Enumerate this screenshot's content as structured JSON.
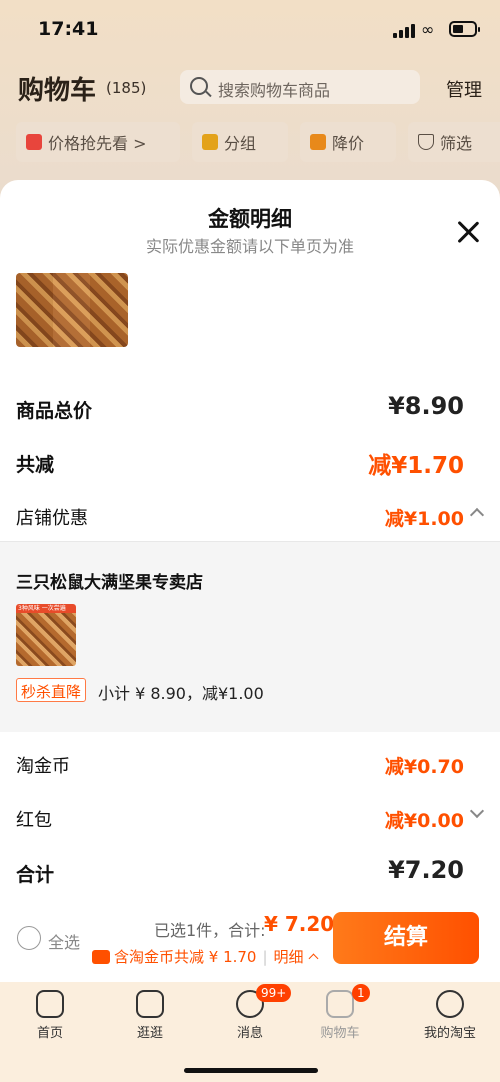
{
  "status_bar": {
    "time": "17:41"
  },
  "cart_header": {
    "title": "购物车",
    "count": "(185)",
    "search_placeholder": "搜索购物车商品",
    "manage": "管理"
  },
  "filter_chips": [
    {
      "label": "价格抢先看 >",
      "icon": "price-tag-icon"
    },
    {
      "label": "分组",
      "icon": "folder-icon"
    },
    {
      "label": "降价",
      "icon": "down-arrow-icon"
    },
    {
      "label": "筛选",
      "icon": "filter-icon"
    }
  ],
  "sheet": {
    "title": "金额明细",
    "subtitle": "实际优惠金额请以下单页为准",
    "rows": {
      "total_price": {
        "label": "商品总价",
        "value": "¥8.90"
      },
      "total_discount": {
        "label": "共减",
        "value": "减¥1.70"
      },
      "shop_discount": {
        "label": "店铺优惠",
        "value": "减¥1.00"
      },
      "tao_coin": {
        "label": "淘金币",
        "value": "减¥0.70"
      },
      "red_packet": {
        "label": "红包",
        "value": "减¥0.00"
      },
      "sum": {
        "label": "合计",
        "value": "¥7.20"
      }
    },
    "shop": {
      "name": "三只松鼠大满坚果专卖店",
      "image_text": "3种风味 一次尝遍",
      "tag": "秒杀直降",
      "subtotal": "小计 ¥ 8.90，减¥1.00"
    }
  },
  "checkout": {
    "select_all": "全选",
    "selected": "已选1件，合计:",
    "total": "¥ 7.20",
    "coin_note": "含淘金币共减 ¥ 1.70",
    "detail": "明细",
    "pay_button": "结算"
  },
  "tabbar": [
    {
      "label": "首页",
      "icon": "home-icon"
    },
    {
      "label": "逛逛",
      "icon": "video-icon"
    },
    {
      "label": "消息",
      "icon": "message-icon",
      "badge": "99+"
    },
    {
      "label": "购物车",
      "icon": "cart-icon",
      "badge": "1",
      "active": true
    },
    {
      "label": "我的淘宝",
      "icon": "smile-icon"
    }
  ],
  "colors": {
    "accent": "#ff5000",
    "tabbar_bg": "#fbeedd"
  }
}
